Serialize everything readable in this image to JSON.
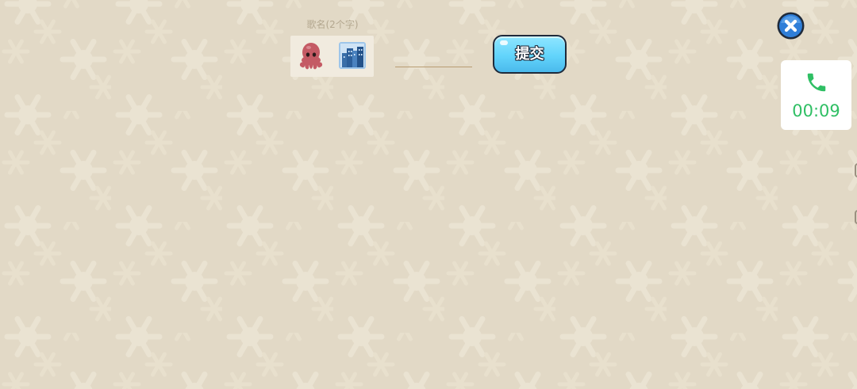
{
  "puzzle": {
    "label": "歌名(2个字)",
    "emoji_clues": [
      "octopus-icon",
      "cityscape-icon"
    ],
    "answer_value": "",
    "answer_placeholder": ""
  },
  "actions": {
    "submit_label": "提交"
  },
  "call": {
    "timer": "00:09"
  },
  "colors": {
    "background": "#e2d9c6",
    "snowflake": "#eae3d2",
    "label_text": "#b3a78f",
    "submit_fill": "#62d4fb",
    "submit_outline": "#1f2a3a",
    "close_fill": "#2f7ed8",
    "call_green": "#2fbf64"
  }
}
